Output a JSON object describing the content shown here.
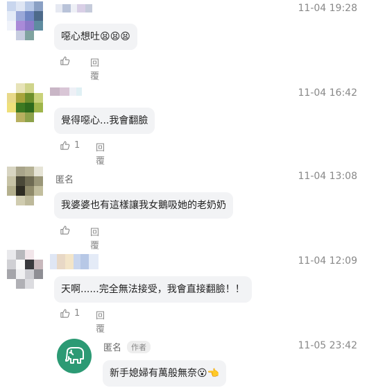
{
  "comments": [
    {
      "name": "",
      "time": "11-04 19:28",
      "text": "噁心想吐😫😫😫",
      "likes": "",
      "reply_label": "回覆"
    },
    {
      "name": "",
      "time": "11-04 16:42",
      "text": "覺得噁心...我會翻臉",
      "likes": "1",
      "reply_label": "回覆"
    },
    {
      "name": "匿名",
      "time": "11-04 13:08",
      "text": "我婆婆也有這樣讓我女鵝吸她的老奶奶",
      "likes": "",
      "reply_label": "回覆"
    },
    {
      "name": "",
      "time": "11-04 12:09",
      "text": "天啊......完全無法接受，我會直接翻臉！！",
      "likes": "1",
      "reply_label": "回覆"
    }
  ],
  "author_reply": {
    "name": "匿名",
    "badge": "作者",
    "time": "11-05 23:42",
    "text": "新手媳婦有萬般無奈😮👈",
    "avatar_icon": "elephant-icon",
    "avatar_color": "#2c9a74"
  },
  "colors": {
    "bubble": "#f2f3f5",
    "muted": "#888888"
  }
}
